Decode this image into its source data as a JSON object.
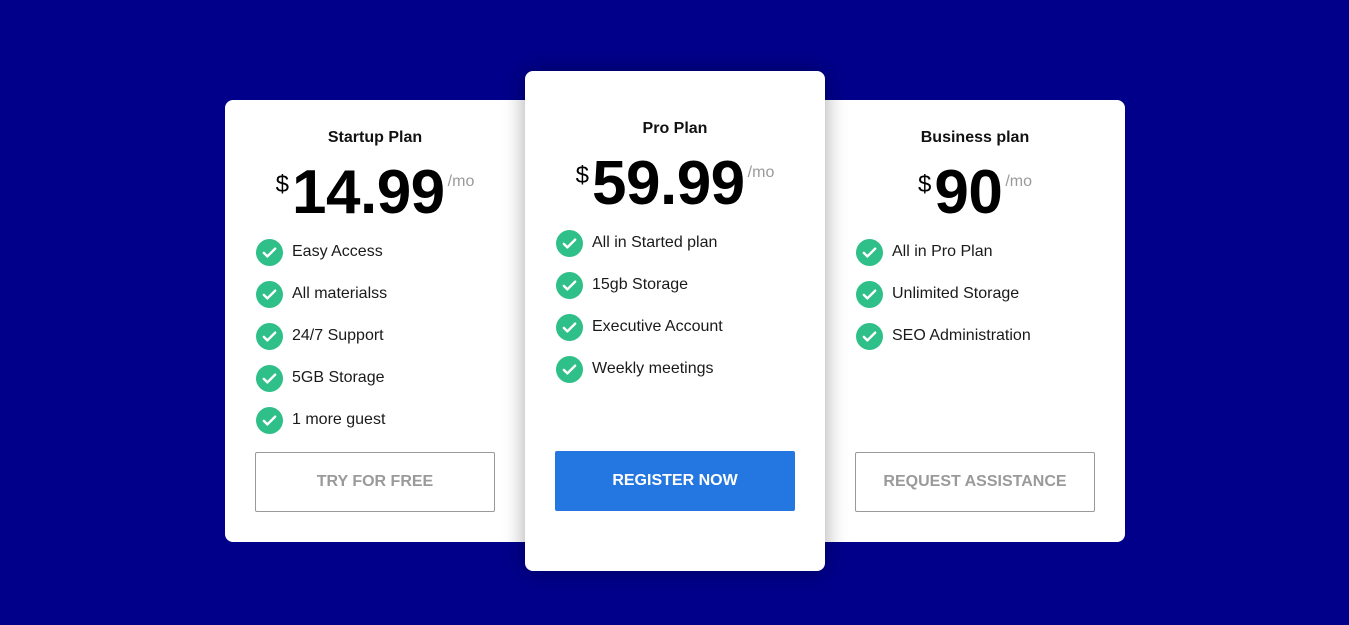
{
  "plans": [
    {
      "name": "Startup Plan",
      "currency": "$",
      "amount": "14.99",
      "period": "/mo",
      "features": [
        "Easy Access",
        "All materialss",
        "24/7 Support",
        "5GB Storage",
        "1 more guest"
      ],
      "cta": "TRY FOR FREE"
    },
    {
      "name": "Pro Plan",
      "currency": "$",
      "amount": "59.99",
      "period": "/mo",
      "features": [
        "All in Started plan",
        "15gb Storage",
        "Executive Account",
        "Weekly meetings"
      ],
      "cta": "REGISTER NOW"
    },
    {
      "name": "Business plan",
      "currency": "$",
      "amount": "90",
      "period": "/mo",
      "features": [
        "All in Pro Plan",
        "Unlimited Storage",
        "SEO Administration"
      ],
      "cta": "REQUEST ASSISTANCE"
    }
  ],
  "colors": {
    "background": "#00008b",
    "check": "#2fbf88",
    "primary_button": "#2477e0",
    "muted_text": "#9a9a9a"
  },
  "icons": {
    "feature_bullet": "check-circle-icon"
  }
}
